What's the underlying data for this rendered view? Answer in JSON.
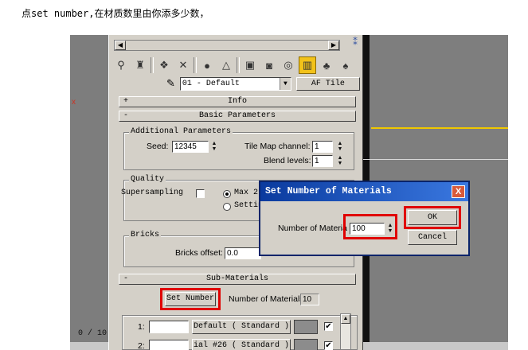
{
  "caption": "点set number,在材质数里由你添多少数，",
  "viewport": {
    "left_axis_label": "x",
    "frame_counter": "0 / 10"
  },
  "toolbar": {
    "icons": [
      "get-material-icon",
      "put-to-scene-icon",
      "assign-material-icon",
      "reset-icon",
      "copy-material-icon",
      "unique-icon",
      "put-to-library-icon",
      "material-id-icon",
      "show-map-icon",
      "show-end-result-icon",
      "go-to-parent-icon",
      "go-forward-icon"
    ],
    "active_color": "#f2c21a"
  },
  "material": {
    "name": "01 - Default",
    "type_button": "AF Tile"
  },
  "rollouts": {
    "info": {
      "toggle": "+",
      "title": "Info"
    },
    "basic": {
      "toggle": "-",
      "title": "Basic Parameters"
    },
    "sub": {
      "toggle": "-",
      "title": "Sub-Materials"
    }
  },
  "additional_params": {
    "title": "Additional Parameters",
    "seed_label": "Seed:",
    "seed_value": "12345",
    "tile_map_label": "Tile Map channel:",
    "tile_map_value": "1",
    "blend_label": "Blend levels:",
    "blend_value": "1"
  },
  "quality": {
    "title": "Quality",
    "supersampling_label": "Supersampling",
    "max_label": "Max 2",
    "setting_label": "Settin"
  },
  "bricks": {
    "title": "Bricks",
    "offset_label": "Bricks offset:",
    "offset_value": "0.0"
  },
  "sub_materials": {
    "set_number_button": "Set Number",
    "count_label": "Number of Materials:",
    "count_value": "10",
    "rows": [
      {
        "index": "1:",
        "name": "Default  ( Standard )"
      },
      {
        "index": "2:",
        "name": "ial #26  ( Standard )"
      }
    ]
  },
  "dialog": {
    "title": "Set Number of Materials",
    "close": "X",
    "field_label": "Number of Materia",
    "field_value": "100",
    "ok": "OK",
    "cancel": "Cancel"
  },
  "colors": {
    "highlight": "#e00000",
    "titlebar": "#0a3a9e",
    "panel": "#d4d0c8"
  }
}
